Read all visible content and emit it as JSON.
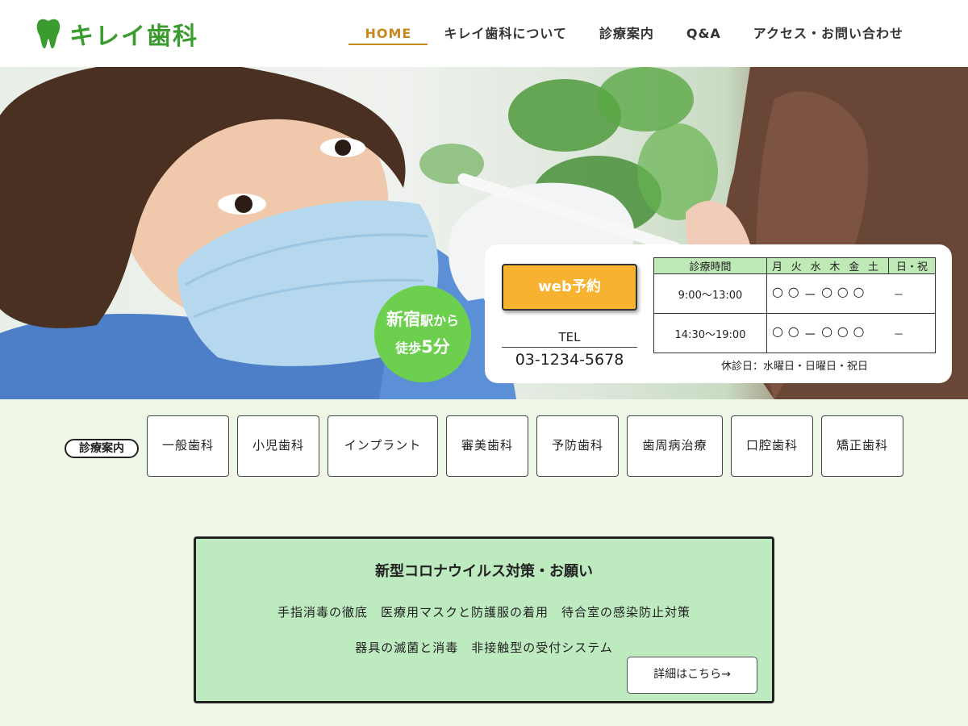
{
  "header": {
    "logo_text": "キレイ歯科",
    "logo_color": "#3a9c2e",
    "nav": [
      {
        "label": "HOME",
        "active": true
      },
      {
        "label": "キレイ歯科について"
      },
      {
        "label": "診療案内"
      },
      {
        "label": "Q&A"
      },
      {
        "label": "アクセス・お問い合わせ"
      }
    ]
  },
  "hero": {
    "badge": {
      "line1_big": "新宿",
      "line1_small": "駅から",
      "line2_small": "徒歩",
      "line2_big": "5分"
    },
    "web_button": "web予約",
    "tel_label": "TEL",
    "tel_number": "03-1234-5678",
    "hours": {
      "header_time": "診療時間",
      "days": [
        "月",
        "火",
        "水",
        "木",
        "金",
        "土"
      ],
      "holiday_header": "日・祝",
      "rows": [
        {
          "time": "9:00〜13:00",
          "marks": [
            "○",
            "○",
            "－",
            "○",
            "○",
            "○"
          ],
          "holiday": "－"
        },
        {
          "time": "14:30〜19:00",
          "marks": [
            "○",
            "○",
            "－",
            "○",
            "○",
            "○"
          ],
          "holiday": "－"
        }
      ],
      "closed_days": "休診日：水曜日・日曜日・祝日"
    }
  },
  "services": {
    "label": "診療案内",
    "items": [
      "一般歯科",
      "小児歯科",
      "インプラント",
      "審美歯科",
      "予防歯科",
      "歯周病治療",
      "口腔歯科",
      "矯正歯科"
    ]
  },
  "notice": {
    "title": "新型コロナウイルス対策・お願い",
    "line1": "手指消毒の徹底　医療用マスクと防護服の着用　待合室の感染防止対策",
    "line2": "器具の滅菌と消毒　非接触型の受付システム",
    "button": "詳細はこちら→"
  },
  "colors": {
    "accent_green": "#6ccf4d",
    "active_nav": "#c88a1f",
    "web_button": "#f7b230",
    "notice_bg": "#bdebbf"
  }
}
